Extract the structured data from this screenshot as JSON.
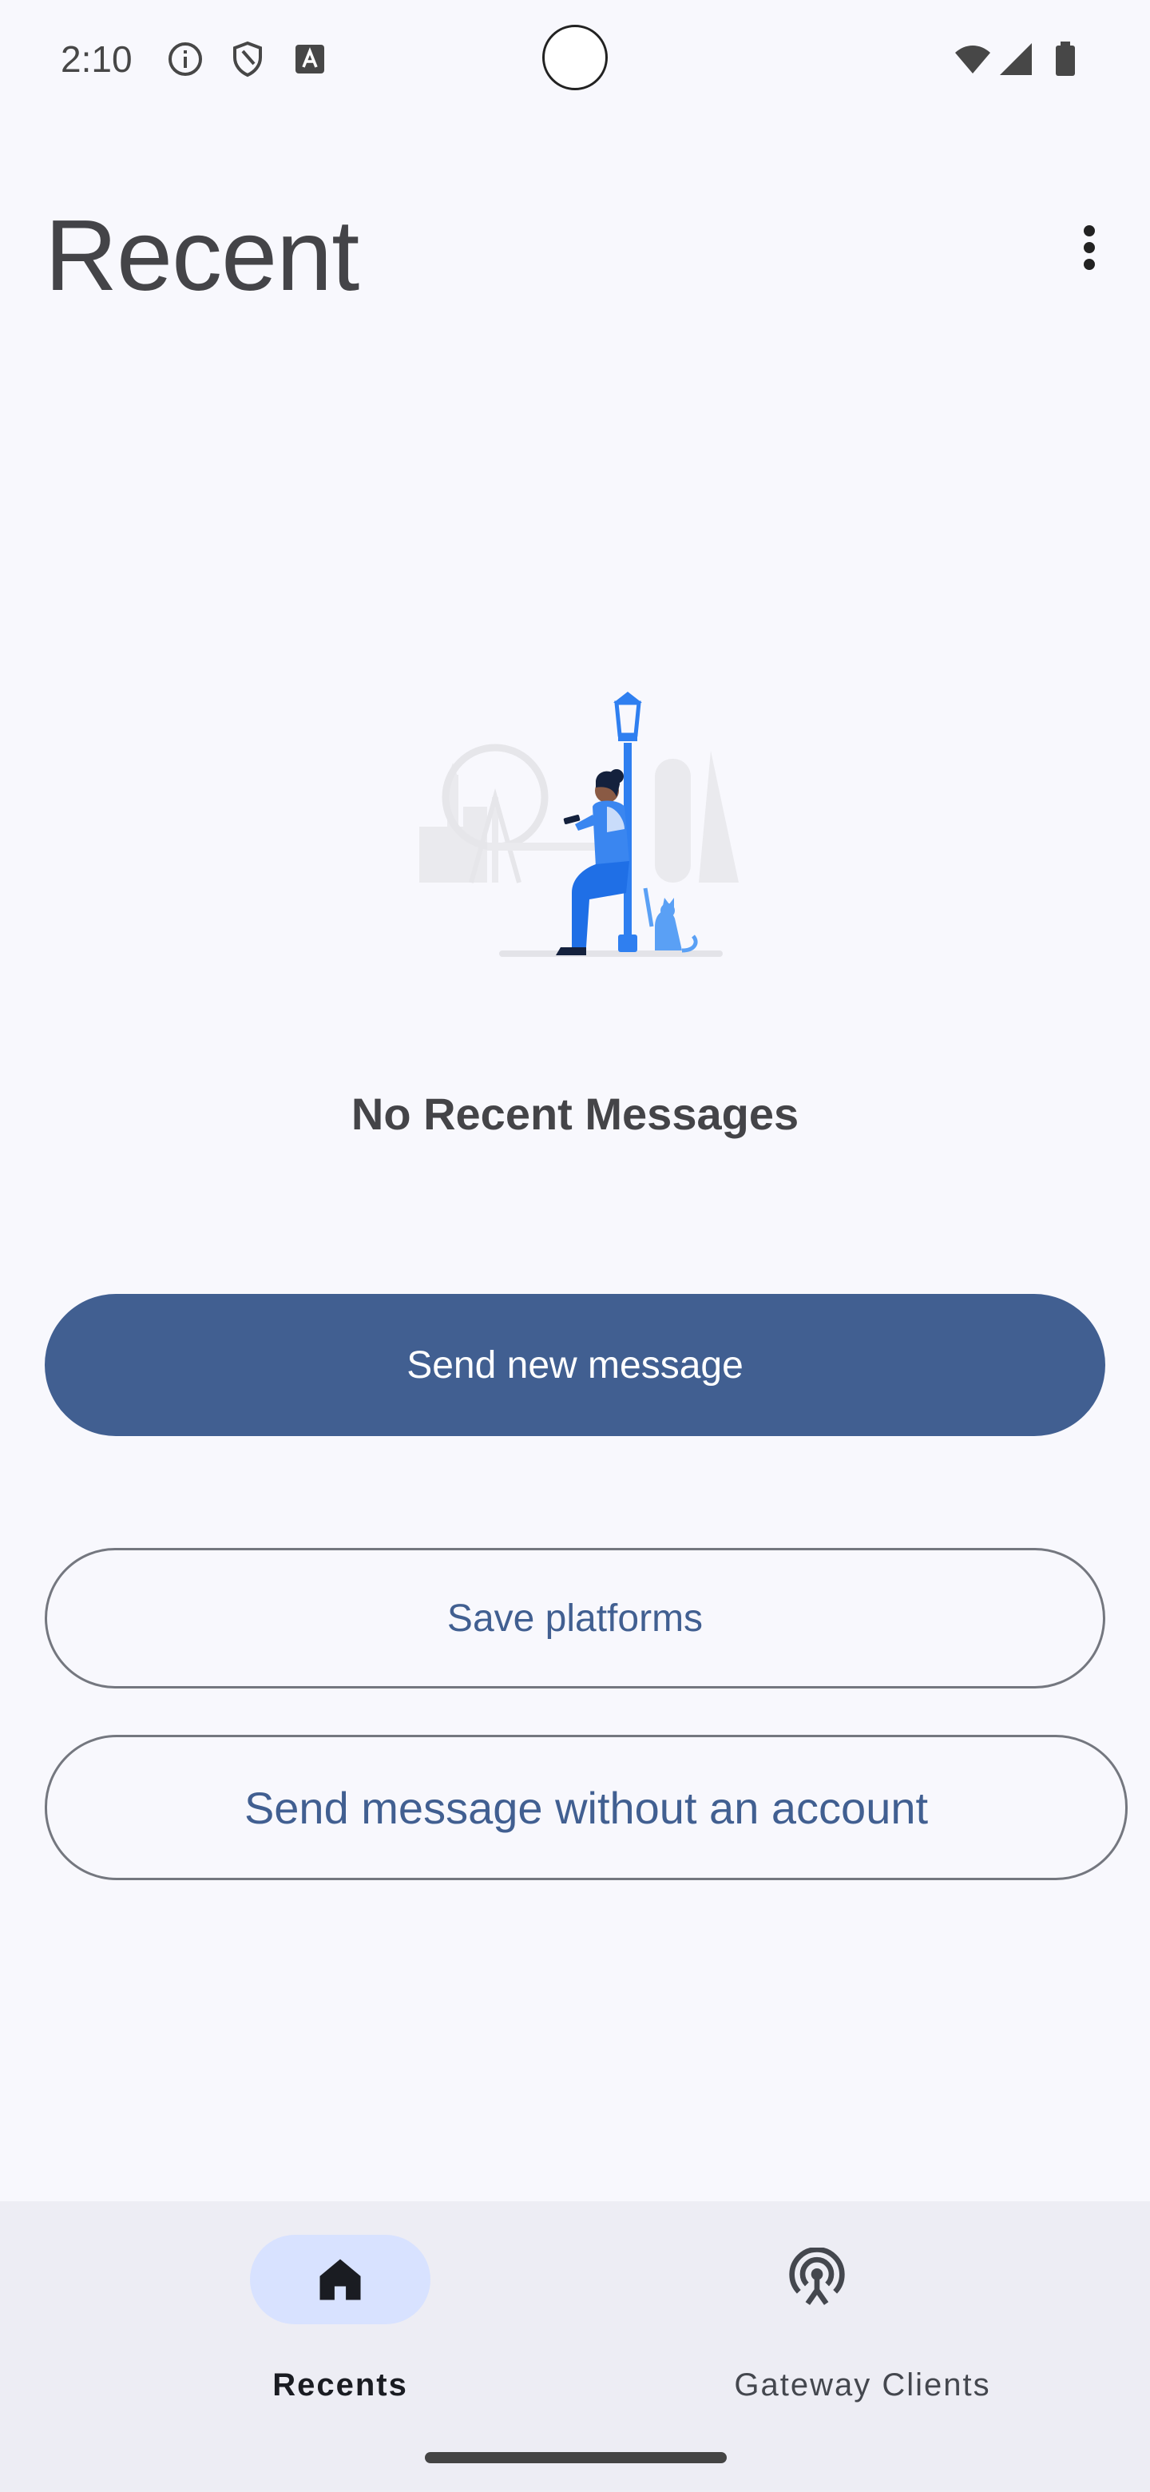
{
  "status_bar": {
    "time": "2:10",
    "icons": [
      "info-icon",
      "shield-icon",
      "font-icon",
      "wifi-icon",
      "signal-icon",
      "battery-icon"
    ]
  },
  "header": {
    "title": "Recent",
    "menu_icon": "more-vert-icon"
  },
  "empty_state": {
    "illustration": "person-lamppost-illustration",
    "title": "No Recent Messages"
  },
  "actions": {
    "send_new": "Send new message",
    "save_platforms": "Save platforms",
    "send_without_account": "Send message without an account"
  },
  "bottom_nav": {
    "items": [
      {
        "label": "Recents",
        "icon": "home-icon",
        "selected": true
      },
      {
        "label": "Gateway Clients",
        "icon": "antenna-icon",
        "selected": false
      }
    ]
  },
  "colors": {
    "background": "#f8f8fd",
    "primary": "#415f91",
    "primary_container": "#d8e2ff",
    "nav_background": "#ededf4",
    "outline": "#74777f",
    "illustration_blue": "#2f7ff0"
  }
}
